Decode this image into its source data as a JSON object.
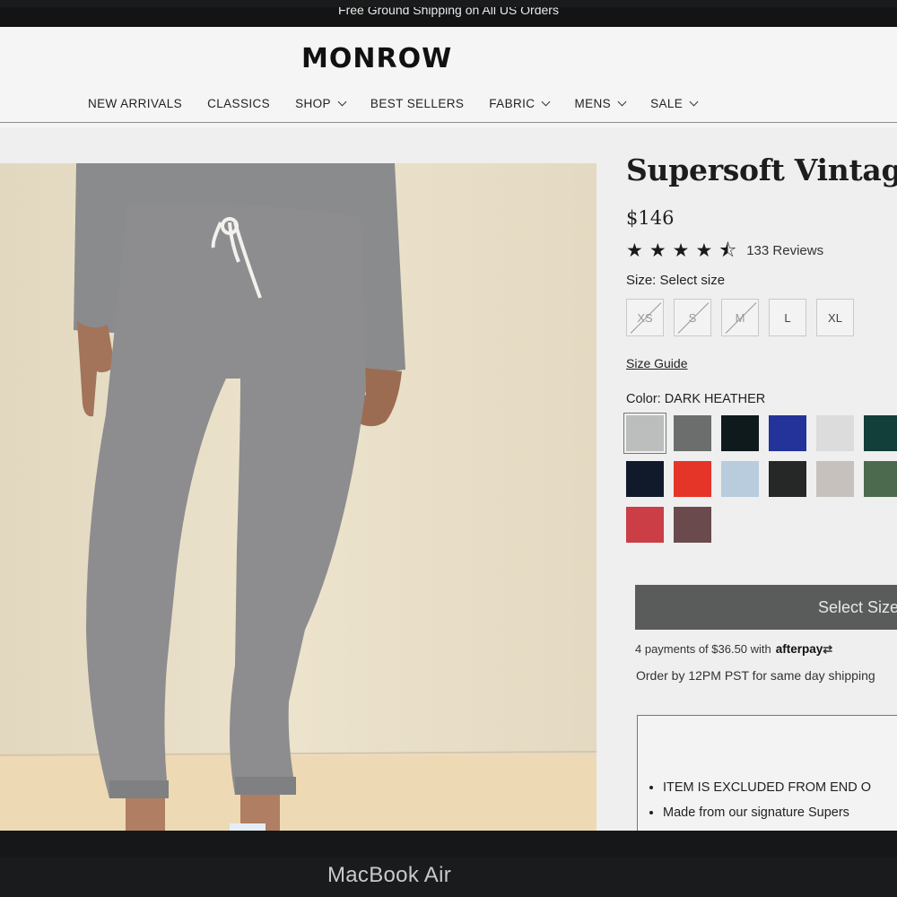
{
  "promo": {
    "text": "Free Ground Shipping on All US Orders"
  },
  "header": {
    "logo": "MONROW",
    "nav": [
      {
        "label": "NEW ARRIVALS",
        "has_dropdown": false
      },
      {
        "label": "CLASSICS",
        "has_dropdown": false
      },
      {
        "label": "SHOP",
        "has_dropdown": true
      },
      {
        "label": "BEST SELLERS",
        "has_dropdown": false
      },
      {
        "label": "FABRIC",
        "has_dropdown": true
      },
      {
        "label": "MENS",
        "has_dropdown": true
      },
      {
        "label": "SALE",
        "has_dropdown": true
      }
    ]
  },
  "product": {
    "title": "Supersoft Vintage S",
    "price": "$146",
    "rating": 4.5,
    "reviews_label": "133 Reviews",
    "size_label": "Size: Select size",
    "sizes": [
      {
        "label": "XS",
        "available": false
      },
      {
        "label": "S",
        "available": false
      },
      {
        "label": "M",
        "available": false
      },
      {
        "label": "L",
        "available": true
      },
      {
        "label": "XL",
        "available": true
      }
    ],
    "size_guide_label": "Size Guide",
    "color_label": "Color: DARK HEATHER",
    "colors": [
      {
        "hex": "#bcbdbd",
        "selected": true
      },
      {
        "hex": "#6c6e6d",
        "selected": false
      },
      {
        "hex": "#0f1a1c",
        "selected": false
      },
      {
        "hex": "#23339a",
        "selected": false
      },
      {
        "hex": "#dcdcdc",
        "selected": false
      },
      {
        "hex": "#123f39",
        "selected": false
      },
      {
        "hex": "#101a2a",
        "selected": false
      },
      {
        "hex": "#e53428",
        "selected": false
      },
      {
        "hex": "#b8ccdd",
        "selected": false
      },
      {
        "hex": "#262827",
        "selected": false
      },
      {
        "hex": "#c6c1bd",
        "selected": false
      },
      {
        "hex": "#4c6b4e",
        "selected": false
      },
      {
        "hex": "#cc3e45",
        "selected": false
      },
      {
        "hex": "#6b4a4d",
        "selected": false
      }
    ],
    "cta_label": "Select Size",
    "afterpay_text": "4 payments of $36.50 with",
    "afterpay_brand": "afterpay",
    "shipping_note": "Order by 12PM PST for same day shipping",
    "info_bullets": [
      "ITEM IS EXCLUDED FROM END O",
      "Made from our signature Supers"
    ]
  },
  "device": {
    "label": "MacBook Air"
  }
}
